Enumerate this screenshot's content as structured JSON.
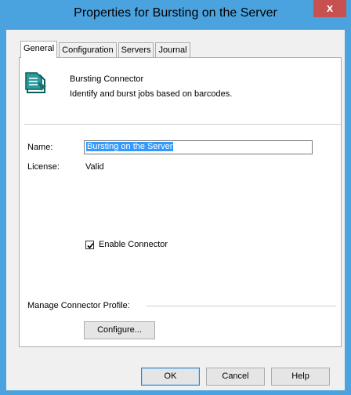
{
  "window": {
    "title": "Properties for Bursting on the Server",
    "close_glyph": "x"
  },
  "tabs": [
    {
      "label": "General"
    },
    {
      "label": "Configuration"
    },
    {
      "label": "Servers"
    },
    {
      "label": "Journal"
    }
  ],
  "connector": {
    "name": "Bursting Connector",
    "description": "Identify and burst jobs based on barcodes.",
    "icon": "connector-document-icon"
  },
  "form": {
    "name_label": "Name:",
    "name_value": "Bursting on the Server",
    "license_label": "License:",
    "license_value": "Valid",
    "enable_label": "Enable Connector",
    "enable_checked": true
  },
  "profile": {
    "group_label": "Manage Connector Profile:",
    "configure_label": "Configure..."
  },
  "footer": {
    "ok_label": "OK",
    "cancel_label": "Cancel",
    "help_label": "Help"
  },
  "colors": {
    "title_bar": "#4aa3df",
    "close_button": "#c75050",
    "selection": "#3399ff"
  }
}
